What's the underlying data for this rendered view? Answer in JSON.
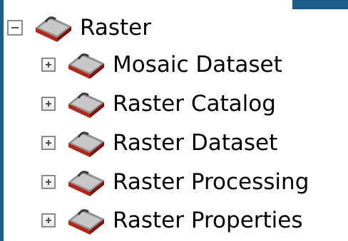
{
  "tree": {
    "root": {
      "label": "Raster",
      "expander": "collapse",
      "icon": "toolbox-icon"
    },
    "children": [
      {
        "label": "Mosaic Dataset",
        "expander": "expand",
        "icon": "toolbox-icon"
      },
      {
        "label": "Raster Catalog",
        "expander": "expand",
        "icon": "toolbox-icon"
      },
      {
        "label": "Raster Dataset",
        "expander": "expand",
        "icon": "toolbox-icon"
      },
      {
        "label": "Raster Processing",
        "expander": "expand",
        "icon": "toolbox-icon"
      },
      {
        "label": "Raster Properties",
        "expander": "expand",
        "icon": "toolbox-icon"
      }
    ]
  },
  "colors": {
    "border_accent": "#1f5d8c",
    "toolbox_red": "#b3261e",
    "toolbox_gray": "#7d7d7d"
  }
}
